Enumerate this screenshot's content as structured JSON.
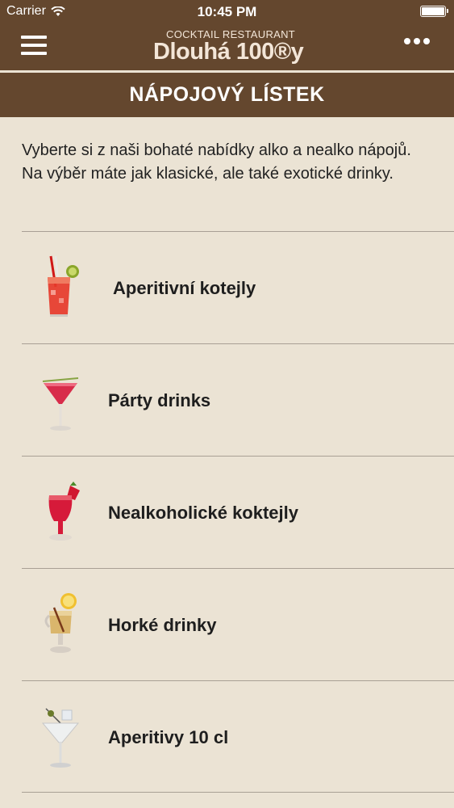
{
  "status_bar": {
    "carrier": "Carrier",
    "time": "10:45 PM"
  },
  "nav": {
    "logo_small": "COCKTAIL RESTAURANT",
    "logo_main": "Dlouhá 100®y"
  },
  "page_title": "NÁPOJOVÝ LÍSTEK",
  "intro": "Vyberte si z naši bohaté nabídky alko a nealko nápojů. Na výběr máte jak klasické, ale také exotické drinky.",
  "menu": [
    {
      "label": "Aperitivní kotejly",
      "icon": "red-cocktail-icon"
    },
    {
      "label": "Párty drinks",
      "icon": "martini-red-icon"
    },
    {
      "label": "Nealkoholické koktejly",
      "icon": "strawberry-drink-icon"
    },
    {
      "label": "Horké drinky",
      "icon": "hot-drink-icon"
    },
    {
      "label": "Aperitivy 10 cl",
      "icon": "martini-olive-icon"
    }
  ]
}
